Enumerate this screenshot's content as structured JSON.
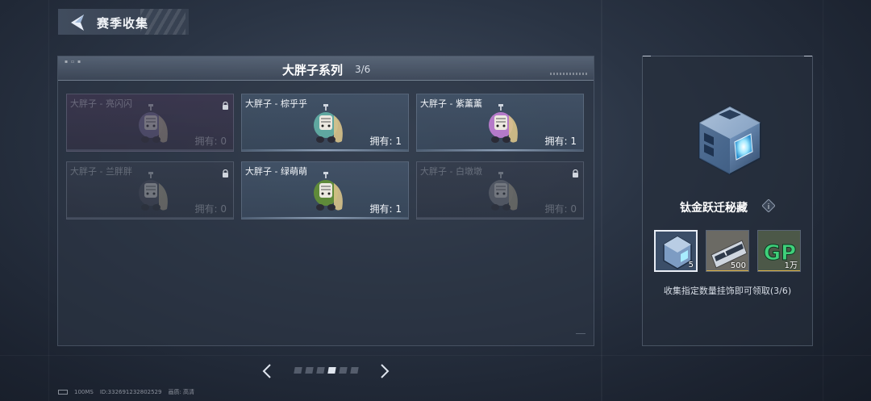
{
  "header": {
    "title": "赛季收集"
  },
  "panel": {
    "title": "大胖子系列",
    "count": "3/6"
  },
  "cards": [
    {
      "name": "大胖子 - 亮闪闪",
      "count": "拥有: 0",
      "locked": true,
      "color": "#7a6fb8"
    },
    {
      "name": "大胖子 - 棕乎乎",
      "count": "拥有: 1",
      "locked": false,
      "color": "#5fa7a0"
    },
    {
      "name": "大胖子 - 紫薰薰",
      "count": "拥有: 1",
      "locked": false,
      "color": "#b57ac9"
    },
    {
      "name": "大胖子 - 兰胖胖",
      "count": "拥有: 0",
      "locked": true,
      "color": "#4a4f66"
    },
    {
      "name": "大胖子 - 绿萌萌",
      "count": "拥有: 1",
      "locked": false,
      "color": "#5f8a3a"
    },
    {
      "name": "大胖子 - 白墩墩",
      "count": "拥有: 0",
      "locked": true,
      "color": "#8c8f99"
    }
  ],
  "pager": {
    "total": 6,
    "active_index": 3
  },
  "footer": {
    "ping": "100MS",
    "id": "ID:332691232802529",
    "quality": "画质: 高清"
  },
  "reward": {
    "name": "钛金跃迁秘藏",
    "items": [
      {
        "label": "crate",
        "qty": "5"
      },
      {
        "label": "ticket",
        "qty": "500"
      },
      {
        "label": "GP",
        "qty": "1万"
      }
    ],
    "description": "收集指定数量挂饰即可领取(3/6)"
  },
  "colors": {
    "accent": "#e9eef6",
    "panel": "#2d3746",
    "text": "#f2f5f9"
  }
}
